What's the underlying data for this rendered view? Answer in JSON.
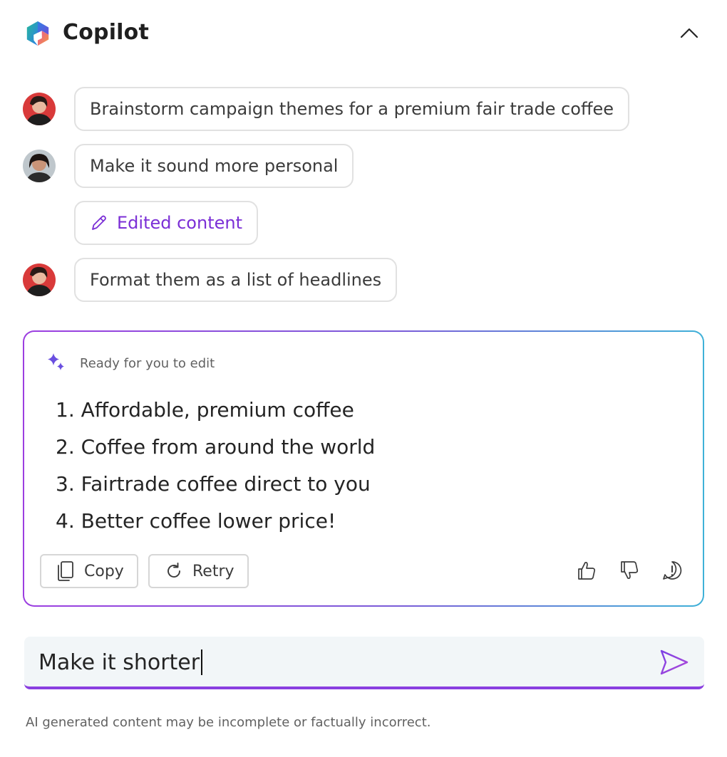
{
  "header": {
    "title": "Copilot",
    "logo_icon": "copilot-logo-icon",
    "collapse_icon": "chevron-up-icon"
  },
  "messages": [
    {
      "avatar_icon": "user-avatar-icon",
      "text": "Brainstorm campaign themes for a premium fair trade coffee"
    },
    {
      "avatar_icon": "user-avatar-icon",
      "text": "Make it sound more personal"
    },
    {
      "icon": "pencil-icon",
      "text": "Edited content"
    },
    {
      "avatar_icon": "user-avatar-icon",
      "text": "Format them as a list of headlines"
    }
  ],
  "response": {
    "label": "Ready for you to edit",
    "icon": "sparkle-icon",
    "items": [
      "1. Affordable, premium coffee",
      "2. Coffee from around the world",
      "3. Fairtrade coffee direct to you",
      "4. Better coffee lower price!"
    ],
    "copy_label": "Copy",
    "retry_label": "Retry",
    "feedback_icons": [
      "thumbs-up-icon",
      "thumbs-down-icon",
      "report-icon"
    ]
  },
  "input": {
    "value": "Make it shorter",
    "send_icon": "send-icon"
  },
  "disclaimer": "AI generated content may be incomplete or factually incorrect.",
  "colors": {
    "accent": "#8a3fe0",
    "edited_text": "#7b2fd6",
    "border": "#e1e1e1",
    "input_bg": "#f2f6f8"
  }
}
